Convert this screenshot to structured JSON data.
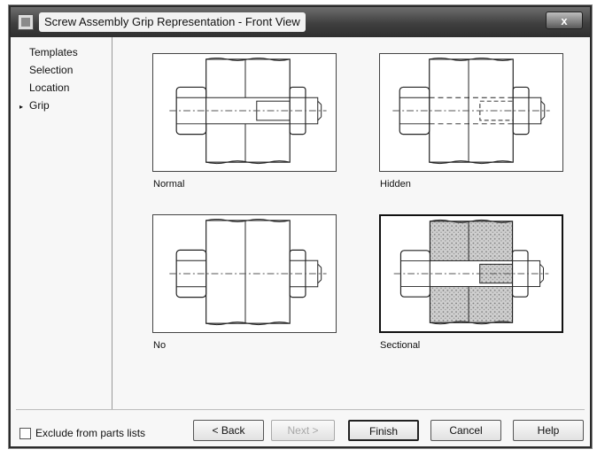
{
  "window": {
    "title": "Screw Assembly Grip Representation - Front View",
    "close_glyph": "x"
  },
  "sidebar": {
    "items": [
      {
        "label": "Templates",
        "current": false
      },
      {
        "label": "Selection",
        "current": false
      },
      {
        "label": "Location",
        "current": false
      },
      {
        "label": "Grip",
        "current": true
      }
    ],
    "current_marker": "▸"
  },
  "options": [
    {
      "label": "Normal",
      "icon": "normal-grip-drawing-icon"
    },
    {
      "label": "Hidden",
      "icon": "hidden-grip-drawing-icon"
    },
    {
      "label": "No",
      "icon": "no-grip-drawing-icon"
    },
    {
      "label": "Sectional",
      "icon": "sectional-grip-drawing-icon"
    }
  ],
  "exclude_checkbox": {
    "label": "Exclude from parts lists",
    "checked": false
  },
  "buttons": {
    "back": "< Back",
    "next": "Next >",
    "finish": "Finish",
    "cancel": "Cancel",
    "help": "Help"
  }
}
